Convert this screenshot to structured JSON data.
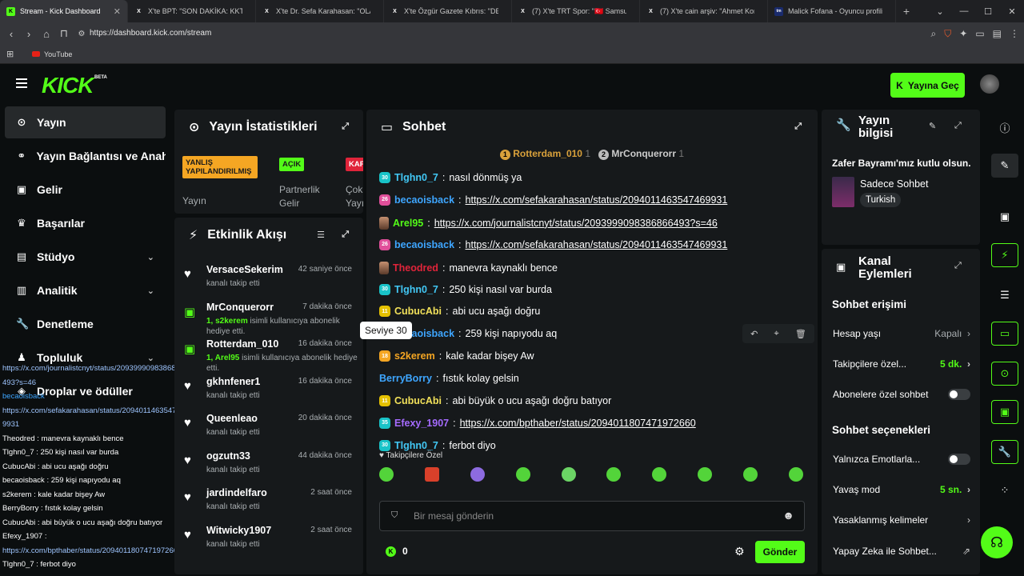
{
  "browser": {
    "tabs": [
      {
        "title": "Stream - Kick Dashboard",
        "active": true,
        "icon": "kick-icon"
      },
      {
        "title": "X'te BPT: \"SON DAKİKA: KKTC Bayır",
        "active": false,
        "icon": "x-icon"
      },
      {
        "title": "X'te Dr. Sefa Karahasan: \"OLAY YER",
        "active": false,
        "icon": "x-icon"
      },
      {
        "title": "X'te Özgür Gazete Kıbrıs: \"DENİZDE",
        "active": false,
        "icon": "x-icon"
      },
      {
        "title": "(7) X'te TRT Spor: \"🇹🇷 Samsunspor",
        "active": false,
        "icon": "x-icon"
      },
      {
        "title": "(7) X'te cain arşiv: \"Ahmet Konanç",
        "active": false,
        "icon": "x-icon"
      },
      {
        "title": "Malick Fofana - Oyuncu profili 26/2",
        "active": false,
        "icon": "tm-icon"
      }
    ],
    "url": "https://dashboard.kick.com/stream",
    "bookmark": "YouTube"
  },
  "header": {
    "logo": "KICK",
    "beta": "BETA",
    "go_live": "Yayına Geç"
  },
  "sidebar": {
    "items": [
      {
        "label": "Yayın",
        "icon": "stream-icon"
      },
      {
        "label": "Yayın Bağlantısı ve Anahtar",
        "icon": "link-icon"
      },
      {
        "label": "Gelir",
        "icon": "revenue-icon"
      },
      {
        "label": "Başarılar",
        "icon": "trophy-icon"
      },
      {
        "label": "Stüdyo",
        "icon": "studio-icon"
      },
      {
        "label": "Analitik",
        "icon": "analytics-icon"
      },
      {
        "label": "Denetleme",
        "icon": "moderation-icon"
      },
      {
        "label": "Topluluk",
        "icon": "community-icon"
      },
      {
        "label": "Droplar ve ödüller",
        "icon": "drops-icon"
      }
    ]
  },
  "overlay_chat": [
    {
      "text": "https://x.com/journalistcnyt/status/2093999098386866493?s=46",
      "kind": "link"
    },
    {
      "text": "becaoisback",
      "kind": "user"
    },
    {
      "text": "https://x.com/sefakarahasan/status/2094011463547469931",
      "kind": "link"
    },
    {
      "text": "Theodred : manevra kaynaklı bence",
      "kind": "msg"
    },
    {
      "text": "Tlghn0_7 : 250 kişi nasıl var burda",
      "kind": "msg"
    },
    {
      "text": "CubucAbi : abi ucu aşağı doğru",
      "kind": "msg"
    },
    {
      "text": "becaoisback : 259 kişi napıyodu aq",
      "kind": "msg"
    },
    {
      "text": "s2kerem : kale kadar bişey Aw",
      "kind": "msg"
    },
    {
      "text": "BerryBorry : fıstık kolay gelsin",
      "kind": "msg"
    },
    {
      "text": "CubucAbi : abi büyük o ucu aşağı doğru batıyor",
      "kind": "msg"
    },
    {
      "text": "Efexy_1907 :",
      "kind": "msg"
    },
    {
      "text": "https://x.com/bpthaber/status/2094011807471972660",
      "kind": "link"
    },
    {
      "text": "Tlghn0_7 : ferbot diyo",
      "kind": "msg"
    }
  ],
  "stats": {
    "title": "Yayın İstatistikleri",
    "cards": [
      {
        "badge": "YANLIŞ YAPILANDIRILMIŞ",
        "label": "Yayın",
        "color": "#f5a623"
      },
      {
        "badge": "AÇIK",
        "label": "Partnerlik Gelir",
        "color": "#53fc18"
      },
      {
        "badge": "KAP",
        "label": "Çok Yayı",
        "color": "#e0243a"
      }
    ]
  },
  "activity": {
    "title": "Etkinlik Akışı",
    "items": [
      {
        "name": "VersaceSekerim",
        "time": "42 saniye önce",
        "desc": "kanalı takip etti",
        "icon": "heart-icon"
      },
      {
        "name": "MrConquerorr",
        "time": "7 dakika önce",
        "gift_user": "1, s2kerem",
        "desc": "isimli kullanıcıya abonelik hediye etti.",
        "icon": "gift-icon"
      },
      {
        "name": "Rotterdam_010",
        "time": "16 dakika önce",
        "gift_user": "1, Arel95",
        "desc": "isimli kullanıcıya abonelik hediye etti.",
        "icon": "gift-icon"
      },
      {
        "name": "gkhnfener1",
        "time": "16 dakika önce",
        "desc": "kanalı takip etti",
        "icon": "heart-icon"
      },
      {
        "name": "Queenleao",
        "time": "20 dakika önce",
        "desc": "kanalı takip etti",
        "icon": "heart-icon"
      },
      {
        "name": "ogzutn33",
        "time": "44 dakika önce",
        "desc": "kanalı takip etti",
        "icon": "heart-icon"
      },
      {
        "name": "jardindelfaro",
        "time": "2 saat önce",
        "desc": "kanalı takip etti",
        "icon": "heart-icon"
      },
      {
        "name": "Witwicky1907",
        "time": "2 saat önce",
        "desc": "kanalı takip etti",
        "icon": "heart-icon"
      }
    ]
  },
  "chat": {
    "title": "Sohbet",
    "pinned": [
      {
        "rank": "1",
        "name": "Rotterdam_010",
        "count": "1"
      },
      {
        "rank": "2",
        "name": "MrConquerorr",
        "count": "1"
      }
    ],
    "messages": [
      {
        "lvl": "30",
        "lvlColor": "#19c3c8",
        "user": "Tlghn0_7",
        "userColor": "#42c8f5",
        "text": "nasıl dönmüş ya",
        "link": false
      },
      {
        "lvl": "26",
        "lvlColor": "#e04f9a",
        "user": "becaoisback",
        "userColor": "#3ea6ff",
        "text": "https://x.com/sefakarahasan/status/2094011463547469931",
        "link": true
      },
      {
        "lvl": "",
        "lvlColor": "",
        "user": "Arel95",
        "userColor": "#53fc18",
        "text": "https://x.com/journalistcnyt/status/2093999098386866493?s=46",
        "link": true
      },
      {
        "lvl": "26",
        "lvlColor": "#e04f9a",
        "user": "becaoisback",
        "userColor": "#3ea6ff",
        "text": "https://x.com/sefakarahasan/status/2094011463547469931",
        "link": true
      },
      {
        "lvl": "",
        "lvlColor": "",
        "user": "Theodred",
        "userColor": "#e0243a",
        "text": "manevra kaynaklı bence",
        "link": false
      },
      {
        "lvl": "30",
        "lvlColor": "#19c3c8",
        "user": "Tlghn0_7",
        "userColor": "#42c8f5",
        "text": "250 kişi nasıl var burda",
        "link": false
      },
      {
        "lvl": "11",
        "lvlColor": "#e5c100",
        "user": "CubucAbi",
        "userColor": "#f1e05a",
        "text": "abi ucu aşağı doğru",
        "link": false
      },
      {
        "lvl": "26",
        "lvlColor": "#e04f9a",
        "user": "becaoisback",
        "userColor": "#3ea6ff",
        "text": "259 kişi napıyodu aq",
        "link": false
      },
      {
        "lvl": "18",
        "lvlColor": "#f5a623",
        "user": "s2kerem",
        "userColor": "#f5a623",
        "text": "kale kadar bişey Aw",
        "link": false
      },
      {
        "lvl": "",
        "lvlColor": "",
        "user": "BerryBorry",
        "userColor": "#3ea6ff",
        "text": "fıstık kolay gelsin",
        "link": false
      },
      {
        "lvl": "11",
        "lvlColor": "#e5c100",
        "user": "CubucAbi",
        "userColor": "#f1e05a",
        "text": "abi büyük o ucu aşağı doğru batıyor",
        "link": false
      },
      {
        "lvl": "35",
        "lvlColor": "#19c3c8",
        "user": "Efexy_1907",
        "userColor": "#a56bff",
        "text": "https://x.com/bpthaber/status/2094011807471972660",
        "link": true
      },
      {
        "lvl": "30",
        "lvlColor": "#19c3c8",
        "user": "Tlghn0_7",
        "userColor": "#42c8f5",
        "text": "ferbot diyo",
        "link": false
      }
    ],
    "tooltip": "Seviye 30",
    "followers_only": "Takipçilere Özel",
    "input_placeholder": "Bir mesaj gönderin",
    "points": "0",
    "send": "Gönder"
  },
  "stream_info": {
    "title": "Yayın bilgisi",
    "stream_title": "Zafer Bayramı'mız kutlu olsun.",
    "category": "Sadece Sohbet",
    "language": "Turkish"
  },
  "channel_actions": {
    "title": "Kanal Eylemleri",
    "chat_access": "Sohbet erişimi",
    "account_age_label": "Hesap yaşı",
    "account_age_value": "Kapalı",
    "followers_only_label": "Takipçilere özel...",
    "followers_only_value": "5 dk.",
    "subs_only_label": "Abonelere özel sohbet",
    "chat_options": "Sohbet seçenekleri",
    "emotes_only_label": "Yalnızca Emotlarla...",
    "slow_mode_label": "Yavaş mod",
    "slow_mode_value": "5 sn.",
    "banned_words_label": "Yasaklanmış kelimeler",
    "ai_label": "Yapay Zeka ile Sohbet..."
  },
  "colors": {
    "accent": "#53fc18",
    "panel": "#16191b",
    "background": "#0b0e0f"
  }
}
